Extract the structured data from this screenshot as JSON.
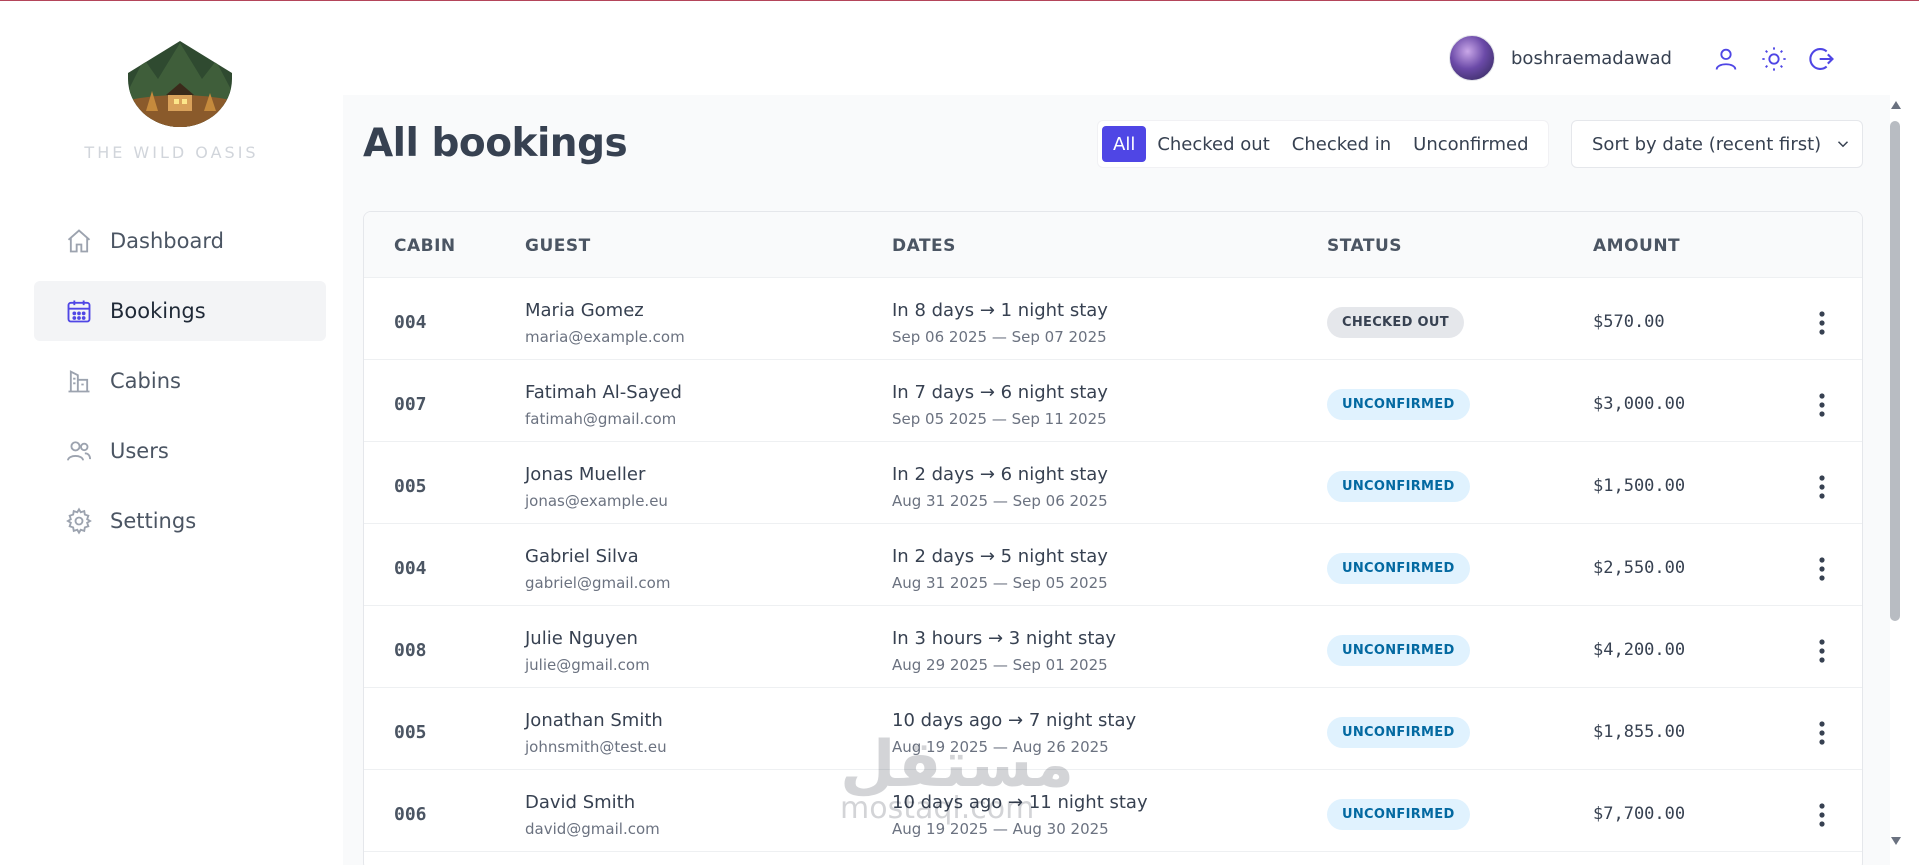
{
  "brand": {
    "name": "THE WILD OASIS",
    "logo_icon": "mountain-cabin-logo"
  },
  "sidebar": {
    "items": [
      {
        "label": "Dashboard",
        "icon": "home-icon",
        "active": false
      },
      {
        "label": "Bookings",
        "icon": "calendar-icon",
        "active": true
      },
      {
        "label": "Cabins",
        "icon": "building-icon",
        "active": false
      },
      {
        "label": "Users",
        "icon": "users-icon",
        "active": false
      },
      {
        "label": "Settings",
        "icon": "gear-icon",
        "active": false
      }
    ]
  },
  "header": {
    "username": "boshraemadawad",
    "icons": [
      "user-icon",
      "sun-icon",
      "logout-icon"
    ]
  },
  "main": {
    "title": "All bookings",
    "filters": [
      "All",
      "Checked out",
      "Checked in",
      "Unconfirmed"
    ],
    "active_filter": "All",
    "sort_label": "Sort by date (recent first)"
  },
  "table": {
    "headers": {
      "cabin": "CABIN",
      "guest": "GUEST",
      "dates": "DATES",
      "status": "STATUS",
      "amount": "AMOUNT"
    },
    "rows": [
      {
        "cabin": "004",
        "guest": "Maria Gomez",
        "email": "maria@example.com",
        "stay": "In 8 days → 1 night stay",
        "range": "Sep 06 2025 — Sep 07 2025",
        "status": "CHECKED OUT",
        "amount": "$570.00"
      },
      {
        "cabin": "007",
        "guest": "Fatimah Al-Sayed",
        "email": "fatimah@gmail.com",
        "stay": "In 7 days → 6 night stay",
        "range": "Sep 05 2025 — Sep 11 2025",
        "status": "UNCONFIRMED",
        "amount": "$3,000.00"
      },
      {
        "cabin": "005",
        "guest": "Jonas Mueller",
        "email": "jonas@example.eu",
        "stay": "In 2 days → 6 night stay",
        "range": "Aug 31 2025 — Sep 06 2025",
        "status": "UNCONFIRMED",
        "amount": "$1,500.00"
      },
      {
        "cabin": "004",
        "guest": "Gabriel Silva",
        "email": "gabriel@gmail.com",
        "stay": "In 2 days → 5 night stay",
        "range": "Aug 31 2025 — Sep 05 2025",
        "status": "UNCONFIRMED",
        "amount": "$2,550.00"
      },
      {
        "cabin": "008",
        "guest": "Julie Nguyen",
        "email": "julie@gmail.com",
        "stay": "In 3 hours → 3 night stay",
        "range": "Aug 29 2025 — Sep 01 2025",
        "status": "UNCONFIRMED",
        "amount": "$4,200.00"
      },
      {
        "cabin": "005",
        "guest": "Jonathan Smith",
        "email": "johnsmith@test.eu",
        "stay": "10 days ago → 7 night stay",
        "range": "Aug 19 2025 — Aug 26 2025",
        "status": "UNCONFIRMED",
        "amount": "$1,855.00"
      },
      {
        "cabin": "006",
        "guest": "David Smith",
        "email": "david@gmail.com",
        "stay": "10 days ago → 11 night stay",
        "range": "Aug 19 2025 — Aug 30 2025",
        "status": "UNCONFIRMED",
        "amount": "$7,700.00"
      }
    ]
  },
  "colors": {
    "accent": "#4f46e5",
    "unconfirmed_bg": "#e0f2fe",
    "unconfirmed_text": "#0369a1",
    "checked_out_bg": "#e5e7eb"
  },
  "watermark": {
    "text": "مستقل",
    "subtext": "mostaql.com"
  }
}
